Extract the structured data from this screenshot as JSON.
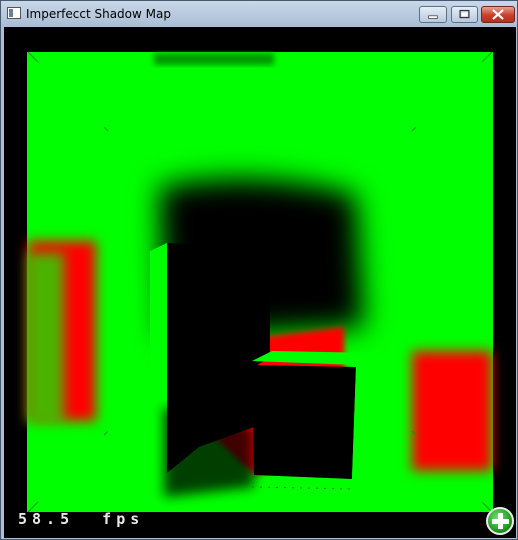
{
  "window": {
    "title": "Imperfecct Shadow Map"
  },
  "controls": {
    "minimize_icon": "minimize-icon",
    "maximize_icon": "maximize-icon",
    "close_icon": "close-icon"
  },
  "overlay": {
    "fps_text": "58.5  fps",
    "add_button_icon": "plus-icon"
  },
  "scene_colors": {
    "green": "#00ff00",
    "red": "#ff0000",
    "black": "#000000"
  }
}
